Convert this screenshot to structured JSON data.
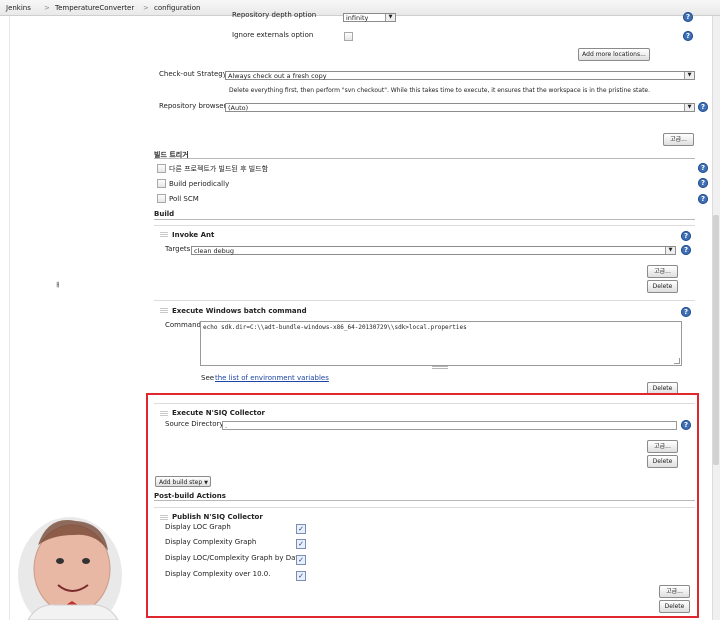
{
  "breadcrumb": {
    "items": [
      "Jenkins",
      "TemperatureConverter",
      "configuration"
    ]
  },
  "scm": {
    "depth_label": "Repository depth option",
    "depth_value": "infinity",
    "ignore_externals_label": "Ignore externals option",
    "add_locations_label": "Add more locations...",
    "checkout_strategy_label": "Check-out Strategy",
    "checkout_strategy_value": "Always check out a fresh copy",
    "checkout_strategy_desc": "Delete everything first, then perform \"svn checkout\". While this takes time to execute, it ensures that the workspace is in the pristine state.",
    "browser_label": "Repository browser",
    "browser_value": "(Auto)",
    "advanced_label": "고급..."
  },
  "triggers": {
    "title": "빌드 트리거",
    "items": [
      "다른 프로젝트가 빌드된 후 빌드함",
      "Build periodically",
      "Poll SCM"
    ]
  },
  "build": {
    "title": "Build",
    "ant": {
      "title": "Invoke Ant",
      "targets_label": "Targets",
      "targets_value": "clean debug",
      "advanced_label": "고급...",
      "delete_label": "Delete"
    },
    "batch": {
      "title": "Execute Windows batch command",
      "command_label": "Command",
      "command_value": "echo sdk.dir=C:\\\\adt-bundle-windows-x86_64-20130729\\\\sdk>local.properties",
      "see_label": "See",
      "env_link": "the list of environment variables",
      "delete_label": "Delete"
    },
    "nsiq": {
      "title": "Execute N'SIQ Collector",
      "source_label": "Source Directory",
      "source_value": ".",
      "advanced_label": "고급...",
      "delete_label": "Delete"
    },
    "add_step_label": "Add build step"
  },
  "post_build": {
    "title": "Post-build Actions",
    "publish": {
      "title": "Publish N'SIQ Collector",
      "options": [
        {
          "label": "Display LOC Graph",
          "checked": true
        },
        {
          "label": "Display Complexity Graph",
          "checked": true
        },
        {
          "label": "Display LOC/Complexity Graph by Day",
          "checked": true
        },
        {
          "label": "Display Complexity over 10.0.",
          "checked": true
        }
      ],
      "advanced_label": "고급...",
      "delete_label": "Delete"
    }
  },
  "sidebar_mark": "ㅐ",
  "colors": {
    "highlight": "#e0262e",
    "help": "#3f6fb5",
    "link": "#1d46a5"
  }
}
